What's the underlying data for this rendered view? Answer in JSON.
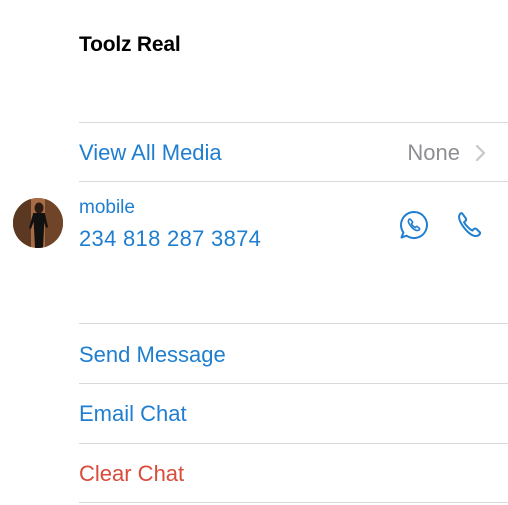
{
  "contact": {
    "name": "Toolz Real"
  },
  "media": {
    "label": "View All Media",
    "value": "None"
  },
  "phone": {
    "type": "mobile",
    "number": "234 818 287 3874"
  },
  "actions": {
    "send_message": "Send Message",
    "email_chat": "Email Chat",
    "clear_chat": "Clear Chat"
  },
  "icons": {
    "chevron": "chevron-right-icon",
    "whatsapp": "whatsapp-icon",
    "phone": "phone-icon"
  },
  "colors": {
    "accent": "#1f7ecf",
    "destructive": "#d94b3b",
    "secondary_text": "#8e8e93",
    "separator": "#d9d9dd"
  }
}
